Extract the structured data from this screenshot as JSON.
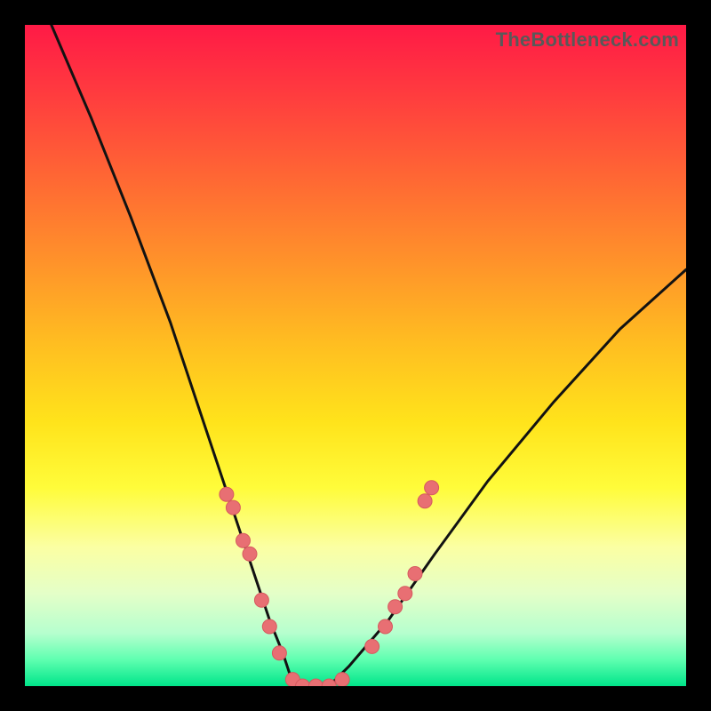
{
  "watermark": "TheBottleneck.com",
  "colors": {
    "curve_stroke": "#121212",
    "marker_fill": "#e86f73",
    "marker_stroke": "#d65a5f"
  },
  "chart_data": {
    "type": "line",
    "title": "",
    "xlabel": "",
    "ylabel": "",
    "xlim": [
      0,
      100
    ],
    "ylim": [
      0,
      100
    ],
    "series": [
      {
        "name": "curve",
        "x": [
          4,
          10,
          16,
          22,
          26,
          30,
          33,
          35,
          37,
          39,
          40,
          42,
          44,
          46,
          49,
          55,
          62,
          70,
          80,
          90,
          100
        ],
        "y": [
          100,
          86,
          71,
          55,
          43,
          31,
          22,
          16,
          10,
          5,
          2,
          0,
          0,
          0,
          3,
          10,
          20,
          31,
          43,
          54,
          63
        ]
      }
    ],
    "markers": [
      {
        "name": "left-cluster",
        "x": [
          30.5,
          31.5,
          33.0,
          34.0,
          35.8,
          37.0,
          38.5,
          40.5
        ],
        "y": [
          29,
          27,
          22,
          20,
          13,
          9,
          5,
          1
        ]
      },
      {
        "name": "valley",
        "x": [
          42,
          44,
          46,
          48
        ],
        "y": [
          0,
          0,
          0,
          1
        ]
      },
      {
        "name": "right-cluster",
        "x": [
          52.5,
          54.5,
          56.0,
          57.5,
          59.0,
          60.5,
          61.5
        ],
        "y": [
          6,
          9,
          12,
          14,
          17,
          28,
          30
        ]
      }
    ],
    "grid": false,
    "legend": false
  }
}
